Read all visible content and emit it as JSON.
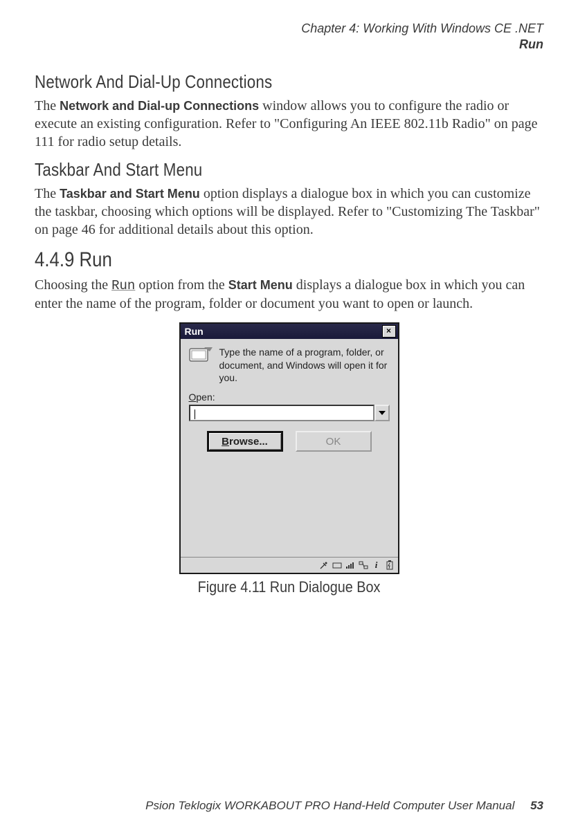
{
  "header": {
    "chapter_line": "Chapter 4: Working With Windows CE .NET",
    "section_line": "Run"
  },
  "sections": {
    "network": {
      "heading": "Network And Dial-Up Connections",
      "para_pre": "The ",
      "para_bold": "Network and Dial-up Connections",
      "para_post": " window allows you to configure the radio or execute an existing configuration. Refer to \"Configuring An IEEE 802.11b Radio\" on page 111 for radio setup details."
    },
    "taskbar": {
      "heading": "Taskbar And Start Menu",
      "para_pre": "The ",
      "para_bold": "Taskbar and Start Menu",
      "para_post": " option displays a dialogue box in which you can customize the taskbar, choosing which options will be displayed. Refer to \"Customizing The Taskbar\" on page 46 for additional details about this option."
    },
    "run": {
      "heading": "4.4.9  Run",
      "para_pre": "Choosing the ",
      "para_mono": "Run",
      "para_mid": " option from the ",
      "para_bold": "Start Menu",
      "para_post": " displays a dialogue box in which you can enter the name of the program, folder or document you want to open or launch."
    }
  },
  "dialog": {
    "title": "Run",
    "close_x": "×",
    "instruction": "Type the name of a program, folder, or document, and Windows will open it for you.",
    "open_label_u": "O",
    "open_label_rest": "pen:",
    "input_value": "",
    "browse_u": "B",
    "browse_rest": "rowse...",
    "ok_label": "OK"
  },
  "tray_icons": [
    "connection-icon",
    "keyboard-icon",
    "signal-icon",
    "network-icon",
    "info-icon",
    "battery-icon"
  ],
  "figure_caption": "Figure 4.11 Run Dialogue Box",
  "footer": {
    "manual": "Psion Teklogix WORKABOUT PRO Hand-Held Computer User Manual",
    "page": "53"
  }
}
